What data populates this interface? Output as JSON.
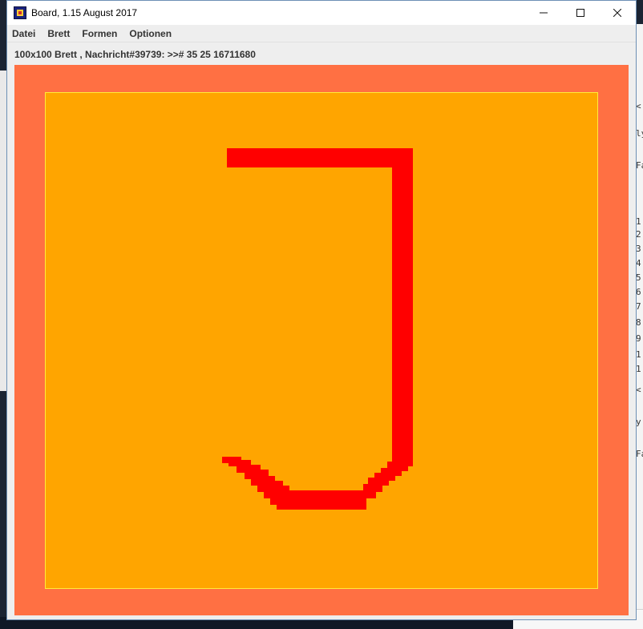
{
  "window": {
    "title": "Board, 1.15 August 2017",
    "controls": {
      "minimize": "minimize",
      "maximize": "maximize",
      "close": "close"
    }
  },
  "menu": {
    "items": [
      "Datei",
      "Brett",
      "Formen",
      "Optionen"
    ]
  },
  "status": {
    "text": "100x100 Brett , Nachricht#39739: >># 35 25 16711680"
  },
  "board": {
    "grid_size": "100x100",
    "colors": {
      "border": "#ff7043",
      "background": "#ffa500",
      "stroke": "#ff0000",
      "frame_line": "#ffeb3b"
    }
  },
  "background": {
    "right_fragments": [
      "<",
      "ly",
      "Fa",
      "1",
      "2",
      "3",
      "4",
      "5",
      "6",
      "7",
      "8",
      "9",
      "1",
      "1",
      "<",
      "y",
      "Fa"
    ]
  }
}
